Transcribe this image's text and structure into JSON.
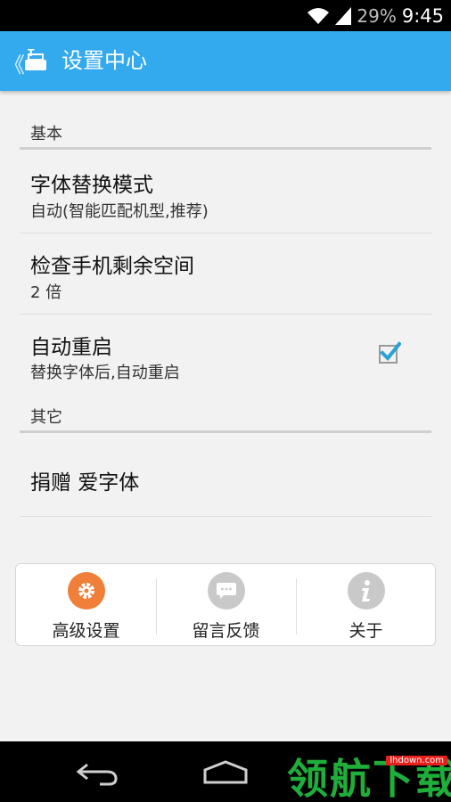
{
  "status_bar": {
    "battery": "29%",
    "time": "9:45"
  },
  "action_bar": {
    "back_glyph": "《",
    "title": "设置中心",
    "icon": "app-font-icon"
  },
  "sections": [
    {
      "header": "基本"
    },
    {
      "header": "其它"
    }
  ],
  "prefs": {
    "font_replace": {
      "title": "字体替换模式",
      "summary": "自动(智能匹配机型,推荐)"
    },
    "check_space": {
      "title": "检查手机剩余空间",
      "summary": "2 倍"
    },
    "auto_reboot": {
      "title": "自动重启",
      "summary": "替换字体后,自动重启",
      "checked": true
    },
    "donate": {
      "title": "捐赠 爱字体"
    }
  },
  "bottom_panel": {
    "items": [
      {
        "label": "高级设置",
        "icon": "gear-icon",
        "color": "#f07f3a"
      },
      {
        "label": "留言反馈",
        "icon": "chat-icon",
        "color": "#c9c9c9"
      },
      {
        "label": "关于",
        "icon": "info-icon",
        "color": "#c9c9c9"
      }
    ]
  },
  "watermark": {
    "text": "领航下载",
    "badge": "lhdown.com"
  },
  "colors": {
    "accent": "#33a9ee",
    "check": "#2aa0d8"
  }
}
